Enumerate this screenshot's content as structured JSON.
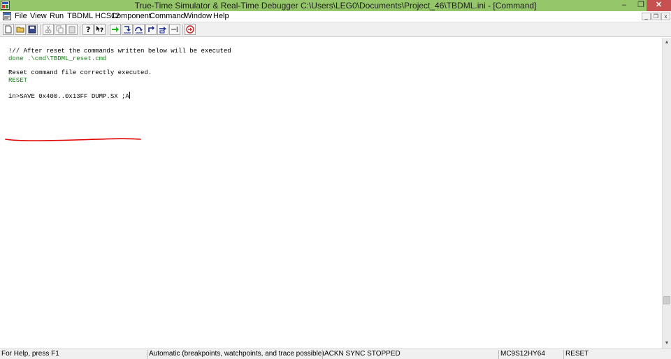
{
  "window": {
    "title": "True-Time Simulator & Real-Time Debugger   C:\\Users\\LEG0\\Documents\\Project_46\\TBDML.ini - [Command]",
    "minimize_glyph": "–",
    "maximize_glyph": "❐",
    "close_glyph": "✕"
  },
  "menu": {
    "items": [
      "File",
      "View",
      "Run",
      "TBDML HCS12",
      "Component",
      "Command",
      "Window",
      "Help"
    ],
    "mdi_minimize": "_",
    "mdi_restore": "❐",
    "mdi_close": "x"
  },
  "toolbar": {
    "buttons": [
      {
        "name": "new-icon"
      },
      {
        "name": "open-icon"
      },
      {
        "name": "save-icon"
      },
      {
        "name": "cut-icon"
      },
      {
        "name": "copy-icon"
      },
      {
        "name": "paste-icon"
      },
      {
        "name": "help-icon"
      },
      {
        "name": "context-help-icon"
      },
      {
        "name": "start-continue-icon"
      },
      {
        "name": "single-step-icon"
      },
      {
        "name": "step-over-icon"
      },
      {
        "name": "step-out-icon"
      },
      {
        "name": "assembly-step-icon"
      },
      {
        "name": "halt-icon"
      },
      {
        "name": "reset-target-icon"
      }
    ]
  },
  "command": {
    "lines": [
      {
        "text": "!// After reset the commands written below will be executed",
        "color": "#000000"
      },
      {
        "text": "done .\\cmd\\TBDML_reset.cmd",
        "color": "#1e7d1e"
      },
      {
        "text": "Reset command file correctly executed.",
        "color": "#000000"
      },
      {
        "text": "RESET",
        "color": "#1e7d1e"
      },
      {
        "text": "in>SAVE 0x400..0x13FF DUMP.SX ;A",
        "color": "#000000"
      }
    ],
    "annotation_color": "#e00000"
  },
  "scrollbar": {
    "up_glyph": "▲",
    "down_glyph": "▼"
  },
  "status": {
    "help": "For Help, press F1",
    "mode": "Automatic (breakpoints, watchpoints, and trace possible)",
    "connection": "ACKN SYNC STOPPED",
    "device": "MC9S12HY64",
    "state": "RESET"
  }
}
